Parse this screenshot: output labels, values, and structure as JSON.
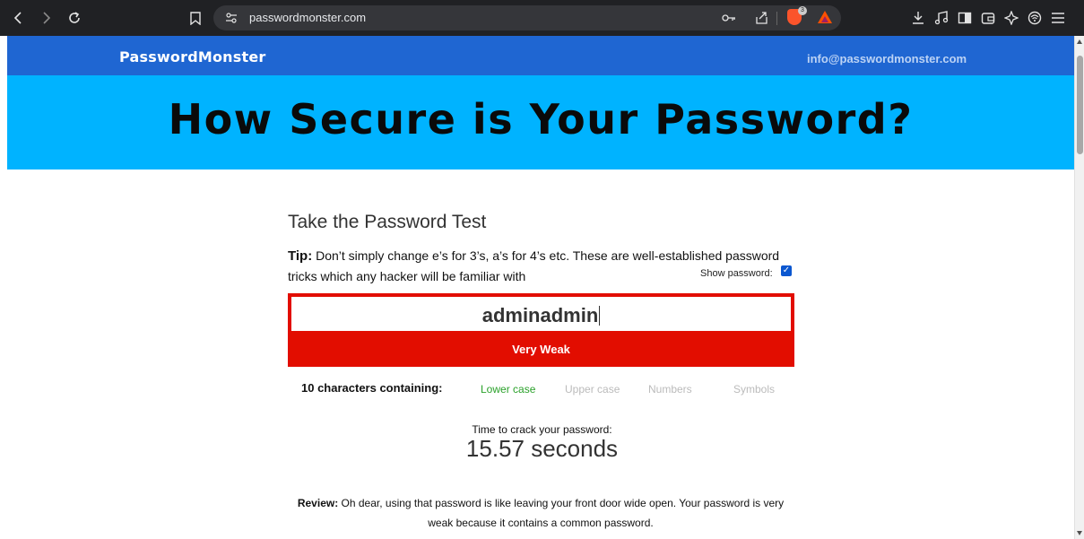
{
  "browser": {
    "url": "passwordmonster.com"
  },
  "brave": {
    "badge": "3"
  },
  "site": {
    "logo": "PasswordMonster",
    "email": "info@passwordmonster.com",
    "hero_title": "How Secure is Your Password?"
  },
  "test": {
    "heading": "Take the Password Test",
    "tip_label": "Tip:",
    "tip_text": " Don’t simply change e’s for 3’s, a’s for 4’s etc. These are well-established password tricks which any hacker will be familiar with",
    "show_password_label": "Show password:",
    "show_password_checked": true,
    "password_value": "adminadmin",
    "strength_label": "Very Weak",
    "char_count_label": "10 characters containing:",
    "char_types": {
      "lower": "Lower case",
      "upper": "Upper case",
      "numbers": "Numbers",
      "symbols": "Symbols"
    },
    "crack_label": "Time to crack your password:",
    "crack_value": "15.57 seconds",
    "review_label": "Review:",
    "review_text": " Oh dear, using that password is like leaving your front door wide open. Your password is very weak because it contains a common password."
  },
  "colors": {
    "nav_bg": "#1f66d2",
    "hero_bg": "#00b3ff",
    "strength_bg": "#e20d00",
    "lower_case_active": "#2aa12a",
    "inactive_type": "#bbbbbb"
  }
}
